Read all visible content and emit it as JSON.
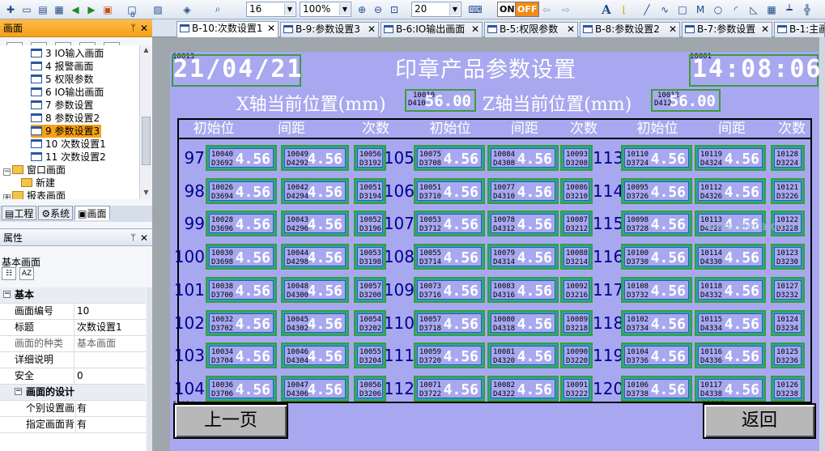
{
  "toolbar": {
    "font_size": "16",
    "zoom": "100%",
    "grid": "20",
    "on_label": "ON",
    "off_label": "OFF",
    "page_num": "8",
    "text_tool": "A"
  },
  "left_panel": {
    "title": "画面",
    "tree": [
      {
        "num": "3",
        "label": "3 IO输入画面"
      },
      {
        "num": "4",
        "label": "4 报警画面"
      },
      {
        "num": "5",
        "label": "5 权限参数"
      },
      {
        "num": "6",
        "label": "6 IO输出画面"
      },
      {
        "num": "7",
        "label": "7 参数设置"
      },
      {
        "num": "8",
        "label": "8 参数设置2"
      },
      {
        "num": "9",
        "label": "9 参数设置3"
      },
      {
        "num": "10",
        "label": "10 次数设置1"
      },
      {
        "num": "11",
        "label": "11 次数设置2"
      },
      {
        "num": "",
        "label": "窗口画面"
      },
      {
        "num": "",
        "label": "新建"
      },
      {
        "num": "",
        "label": "报表画面"
      }
    ],
    "tabs": [
      "工程",
      "系统",
      "画面"
    ]
  },
  "properties": {
    "title": "属性",
    "object_name": "基本画面",
    "rows": [
      {
        "type": "group",
        "k": "基本",
        "v": ""
      },
      {
        "type": "row",
        "k": "画面编号",
        "v": "10"
      },
      {
        "type": "row",
        "k": "标题",
        "v": "次数设置1"
      },
      {
        "type": "muted",
        "k": "画面的种类",
        "v": "基本画面"
      },
      {
        "type": "row",
        "k": "详细说明",
        "v": ""
      },
      {
        "type": "row",
        "k": "安全",
        "v": "0"
      },
      {
        "type": "group2",
        "k": "画面的设计",
        "v": ""
      },
      {
        "type": "row",
        "k": "个别设置画",
        "v": "有"
      },
      {
        "type": "row",
        "k": "指定画面背",
        "v": "有"
      }
    ]
  },
  "tabs": [
    {
      "label": "B-10:次数设置1"
    },
    {
      "label": "B-9:参数设置3"
    },
    {
      "label": "B-6:IO输出画面"
    },
    {
      "label": "B-5:权限参数"
    },
    {
      "label": "B-8:参数设置2"
    },
    {
      "label": "B-7:参数设置"
    },
    {
      "label": "B-1:主画"
    }
  ],
  "screen": {
    "date_tag": "10013",
    "date_value": "21/04/21",
    "time_tag": "10001",
    "time_value": "14:08:06",
    "title": "印章产品参数设置",
    "x_label": "X轴当前位置(mm)",
    "x_tag1": "10010",
    "x_tag2": "D410",
    "x_value": "56.00",
    "z_label": "Z轴当前位置(mm)",
    "z_tag1": "10012",
    "z_tag2": "D412",
    "z_value": "56.00",
    "headers": [
      "初始位",
      "间距",
      "次数",
      "初始位",
      "间距",
      "次数",
      "初始位",
      "间距",
      "次数"
    ],
    "rows": [
      {
        "n1": "97",
        "n2": "105",
        "n3": "113",
        "c": [
          [
            "10040",
            "D3692",
            "4.56"
          ],
          [
            "10049",
            "D4292",
            "4.56"
          ],
          [
            "10056",
            "D3192",
            ""
          ],
          [
            "10075",
            "D3708",
            "4.56"
          ],
          [
            "10084",
            "D4308",
            "4.56"
          ],
          [
            "10093",
            "D3208",
            ""
          ],
          [
            "10110",
            "D3724",
            "4.56"
          ],
          [
            "10119",
            "D4324",
            "4.56"
          ],
          [
            "10128",
            "D3224",
            ""
          ]
        ]
      },
      {
        "n1": "98",
        "n2": "106",
        "n3": "114",
        "c": [
          [
            "10026",
            "D3694",
            "4.56"
          ],
          [
            "10042",
            "D4294",
            "4.56"
          ],
          [
            "10051",
            "D3194",
            ""
          ],
          [
            "10051",
            "D3710",
            "4.56"
          ],
          [
            "10077",
            "D4310",
            "4.56"
          ],
          [
            "10086",
            "D3210",
            ""
          ],
          [
            "10095",
            "D3726",
            "4.56"
          ],
          [
            "10112",
            "D4326",
            "4.56"
          ],
          [
            "10121",
            "D3226",
            ""
          ]
        ]
      },
      {
        "n1": "99",
        "n2": "107",
        "n3": "115",
        "c": [
          [
            "10028",
            "D3696",
            "4.56"
          ],
          [
            "10043",
            "D4296",
            "4.56"
          ],
          [
            "10052",
            "D3196",
            ""
          ],
          [
            "10053",
            "D3712",
            "4.56"
          ],
          [
            "10078",
            "D4312",
            "4.56"
          ],
          [
            "10087",
            "D3212",
            ""
          ],
          [
            "10098",
            "D3728",
            "4.56"
          ],
          [
            "10113",
            "D4328",
            "4.56"
          ],
          [
            "10122",
            "D3228",
            ""
          ]
        ]
      },
      {
        "n1": "100",
        "n2": "108",
        "n3": "116",
        "c": [
          [
            "10030",
            "D3698",
            "4.56"
          ],
          [
            "10044",
            "D4298",
            "4.56"
          ],
          [
            "10053",
            "D3198",
            ""
          ],
          [
            "10055",
            "D3714",
            "4.56"
          ],
          [
            "10079",
            "D4314",
            "4.56"
          ],
          [
            "10088",
            "D3214",
            ""
          ],
          [
            "10100",
            "D3730",
            "4.56"
          ],
          [
            "10114",
            "D4330",
            "4.56"
          ],
          [
            "10123",
            "D3230",
            ""
          ]
        ]
      },
      {
        "n1": "101",
        "n2": "109",
        "n3": "117",
        "c": [
          [
            "10038",
            "D3700",
            "4.56"
          ],
          [
            "10048",
            "D4300",
            "4.56"
          ],
          [
            "10057",
            "D3200",
            ""
          ],
          [
            "10073",
            "D3716",
            "4.56"
          ],
          [
            "10083",
            "D4316",
            "4.56"
          ],
          [
            "10092",
            "D3216",
            ""
          ],
          [
            "10108",
            "D3732",
            "4.56"
          ],
          [
            "10118",
            "D4332",
            "4.56"
          ],
          [
            "10127",
            "D3232",
            ""
          ]
        ]
      },
      {
        "n1": "102",
        "n2": "110",
        "n3": "118",
        "c": [
          [
            "10032",
            "D3702",
            "4.56"
          ],
          [
            "10045",
            "D4302",
            "4.56"
          ],
          [
            "10054",
            "D3202",
            ""
          ],
          [
            "10057",
            "D3718",
            "4.56"
          ],
          [
            "10080",
            "D4318",
            "4.56"
          ],
          [
            "10089",
            "D3218",
            ""
          ],
          [
            "10102",
            "D3734",
            "4.56"
          ],
          [
            "10115",
            "D4334",
            "4.56"
          ],
          [
            "10124",
            "D3234",
            ""
          ]
        ]
      },
      {
        "n1": "103",
        "n2": "111",
        "n3": "119",
        "c": [
          [
            "10034",
            "D3704",
            "4.56"
          ],
          [
            "10046",
            "D4304",
            "4.56"
          ],
          [
            "10055",
            "D3204",
            ""
          ],
          [
            "10059",
            "D3720",
            "4.56"
          ],
          [
            "10081",
            "D4320",
            "4.56"
          ],
          [
            "10090",
            "D3220",
            ""
          ],
          [
            "10104",
            "D3736",
            "4.56"
          ],
          [
            "10116",
            "D4336",
            "4.56"
          ],
          [
            "10125",
            "D3236",
            ""
          ]
        ]
      },
      {
        "n1": "104",
        "n2": "112",
        "n3": "120",
        "c": [
          [
            "10036",
            "D3706",
            "4.56"
          ],
          [
            "10047",
            "D4306",
            "4.56"
          ],
          [
            "10056",
            "D3206",
            ""
          ],
          [
            "10071",
            "D3722",
            "4.56"
          ],
          [
            "10082",
            "D4322",
            "4.56"
          ],
          [
            "10091",
            "D3222",
            ""
          ],
          [
            "10106",
            "D3738",
            "4.56"
          ],
          [
            "10117",
            "D4338",
            "4.56"
          ],
          [
            "10126",
            "D3238",
            ""
          ]
        ]
      }
    ],
    "prev_tag": "10024",
    "prev_label": "上一页",
    "back_tag": "10006",
    "back_label": "返回",
    "watermark": "www.5leca.com"
  }
}
